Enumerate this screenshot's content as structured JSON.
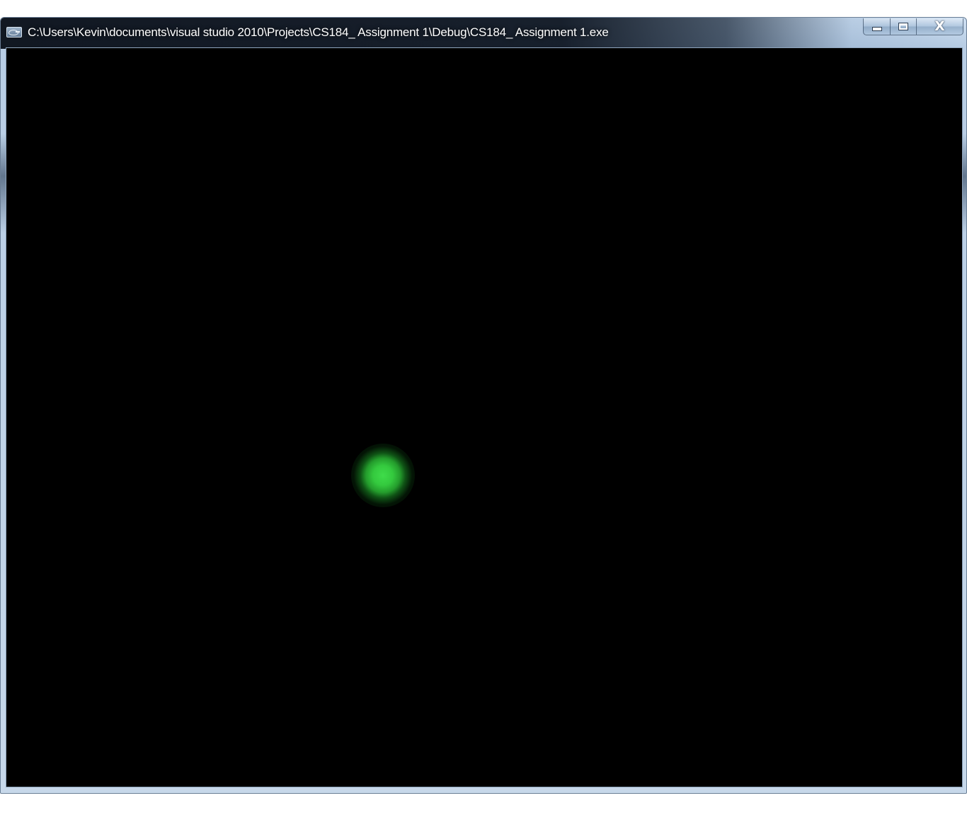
{
  "window": {
    "title": "C:\\Users\\Kevin\\documents\\visual studio 2010\\Projects\\CS184_ Assignment 1\\Debug\\CS184_ Assignment 1.exe",
    "app_icon": "console-app-icon",
    "controls": {
      "minimize_icon": "minimize-icon",
      "maximize_icon": "maximize-icon",
      "close_icon": "close-icon",
      "close_glyph": "X"
    }
  },
  "canvas": {
    "background": "#000000",
    "sphere_color": "#34c93e"
  }
}
